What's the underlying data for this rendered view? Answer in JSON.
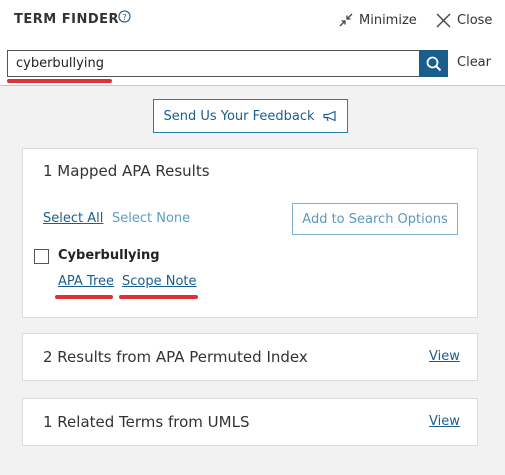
{
  "header": {
    "title": "TERM FINDER",
    "help_icon": "help-circle-icon",
    "minimize_label": "Minimize",
    "minimize_icon": "minimize-arrows-icon",
    "close_label": "Close",
    "close_icon": "close-x-icon"
  },
  "search": {
    "value": "cyberbullying",
    "button_icon": "search-icon",
    "clear_label": "Clear"
  },
  "feedback": {
    "label": "Send Us Your Feedback",
    "icon": "megaphone-icon"
  },
  "mapped_results": {
    "title": "1 Mapped APA Results",
    "select_all": "Select All",
    "select_none": "Select None",
    "add_button": "Add to Search Options",
    "terms": [
      {
        "name": "Cyberbullying",
        "checked": false,
        "links": [
          "APA Tree",
          "Scope Note"
        ]
      }
    ]
  },
  "permuted_index": {
    "title": "2 Results from APA Permuted Index",
    "view_label": "View"
  },
  "umls": {
    "title": "1 Related Terms from UMLS",
    "view_label": "View"
  },
  "colors": {
    "accent": "#1a5e8e",
    "annotation_red": "#e0303a",
    "panel_background": "#f2f2f2"
  }
}
